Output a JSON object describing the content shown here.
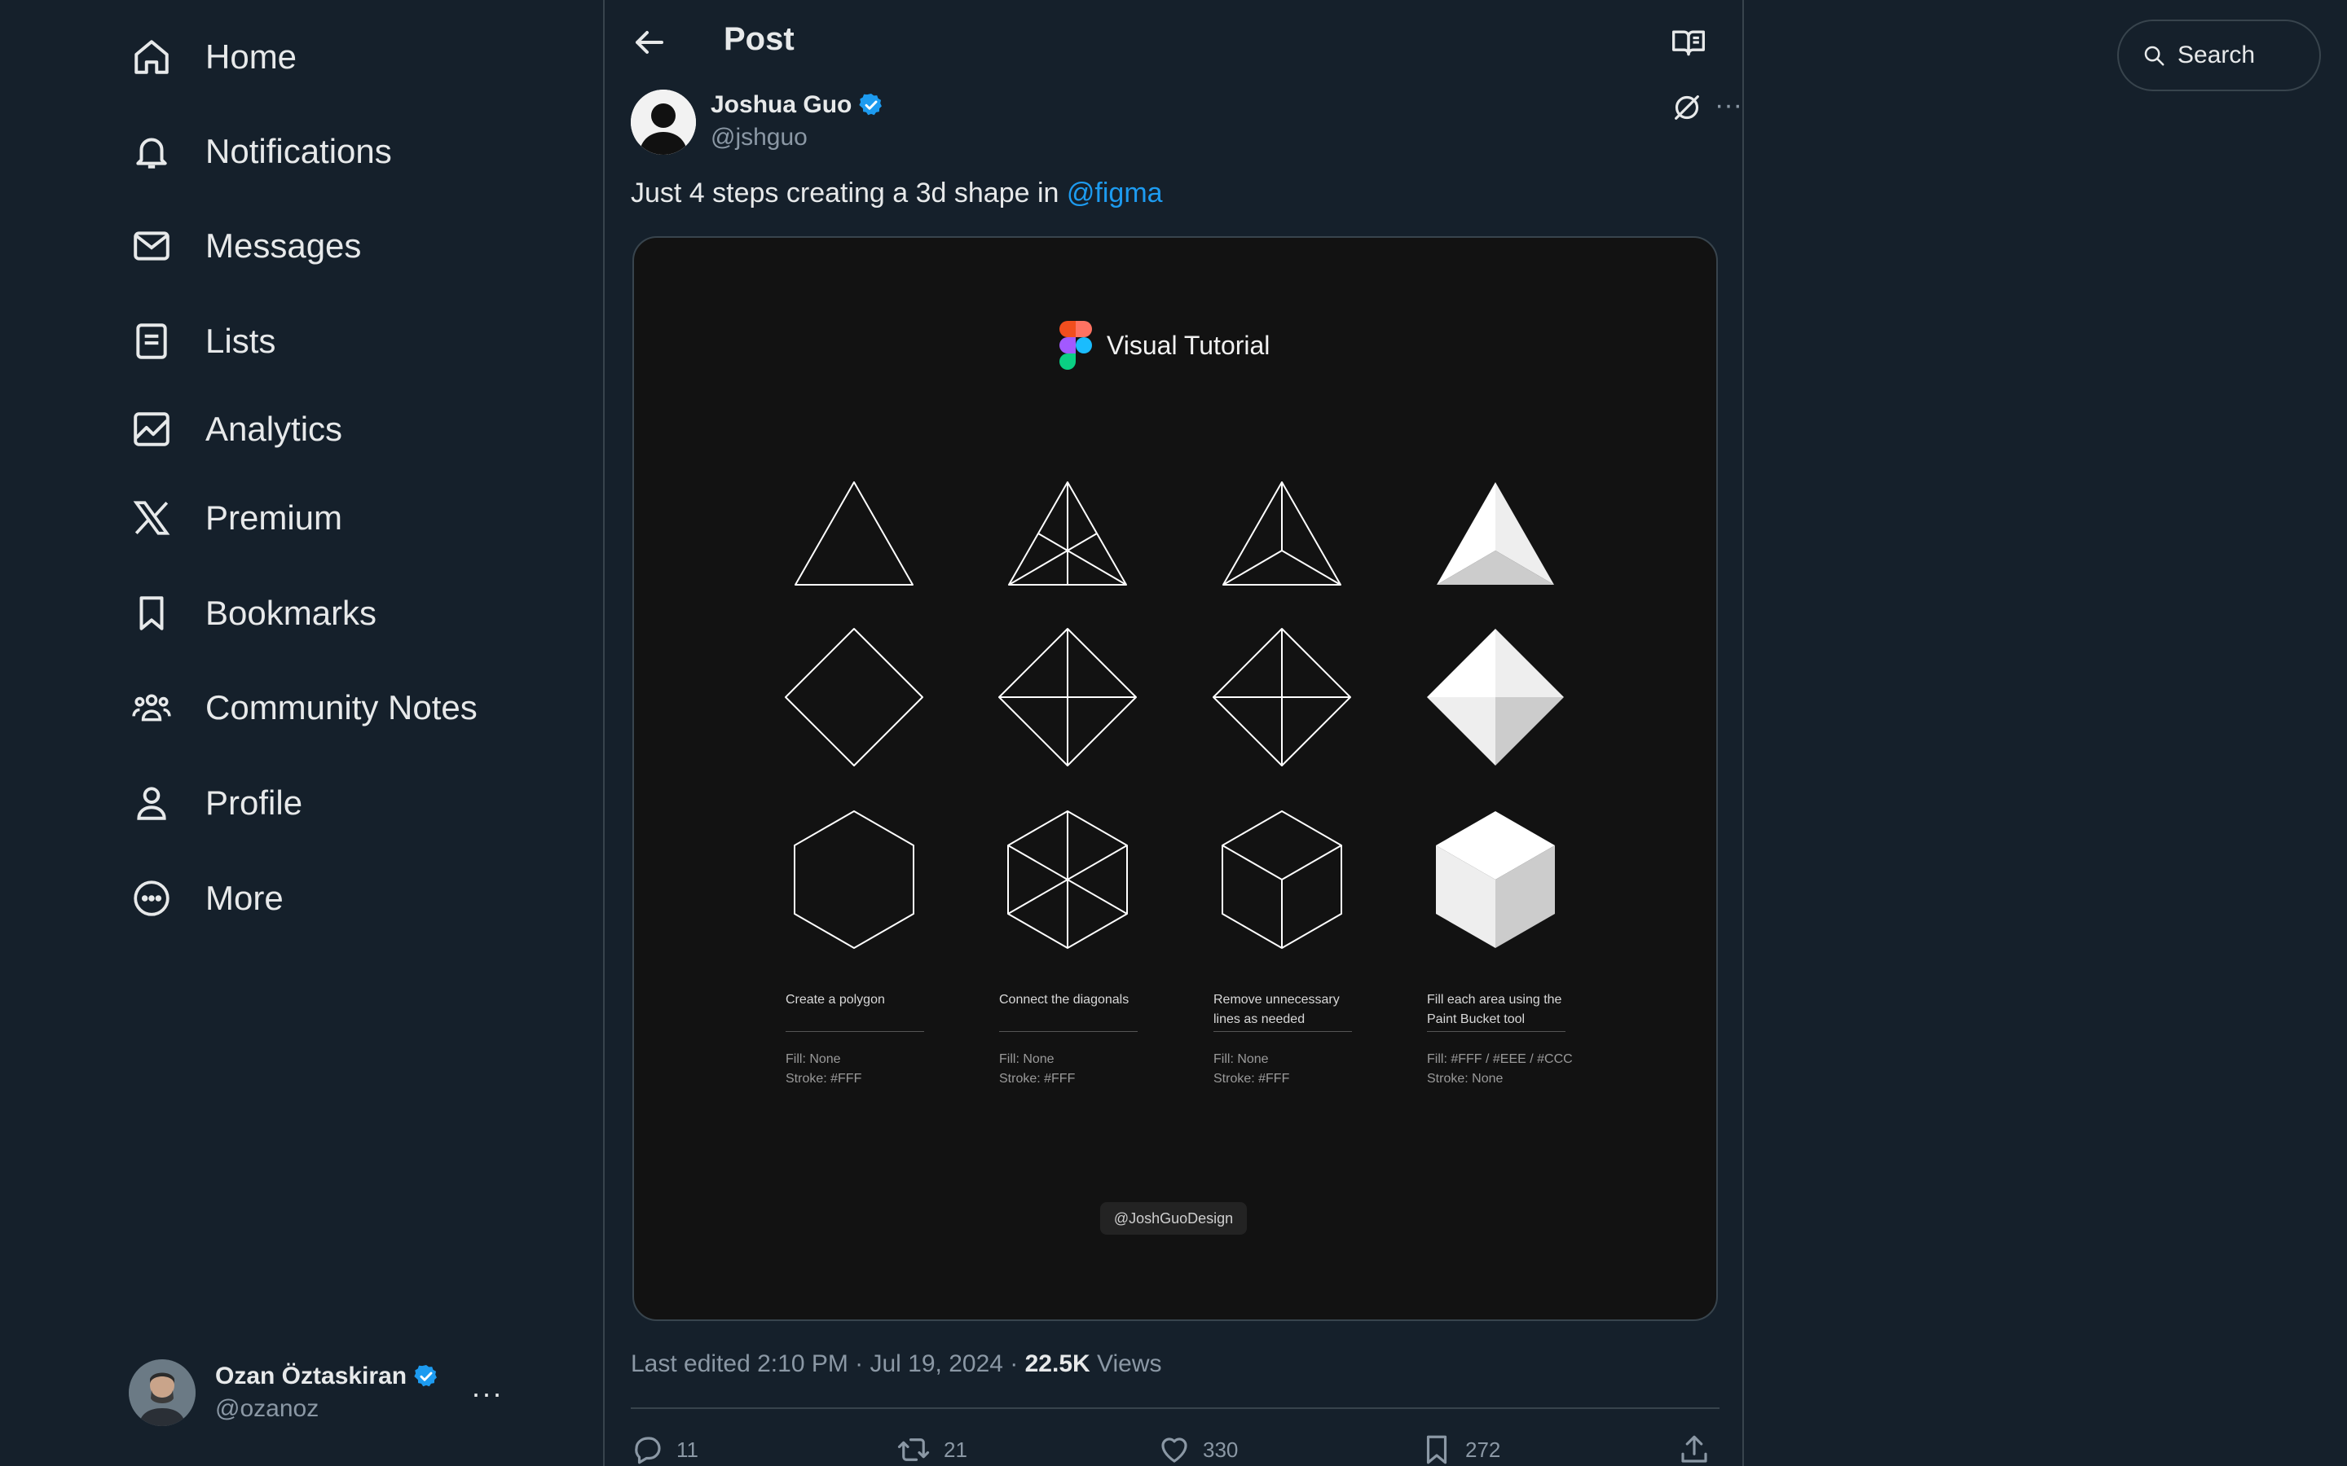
{
  "nav": {
    "items": [
      {
        "label": "Home",
        "icon": "home-icon"
      },
      {
        "label": "Notifications",
        "icon": "bell-icon"
      },
      {
        "label": "Messages",
        "icon": "envelope-icon"
      },
      {
        "label": "Lists",
        "icon": "list-icon"
      },
      {
        "label": "Analytics",
        "icon": "analytics-icon"
      },
      {
        "label": "Premium",
        "icon": "x-logo-icon"
      },
      {
        "label": "Bookmarks",
        "icon": "bookmark-icon"
      },
      {
        "label": "Community Notes",
        "icon": "people-icon"
      },
      {
        "label": "Profile",
        "icon": "person-icon"
      },
      {
        "label": "More",
        "icon": "more-circle-icon"
      }
    ]
  },
  "account": {
    "name": "Ozan Öztaskiran",
    "handle": "@ozanoz",
    "more": "···"
  },
  "header": {
    "title": "Post"
  },
  "post": {
    "author_name": "Joshua Guo",
    "author_handle": "@jshguo",
    "more": "···",
    "text": "Just 4 steps creating a 3d shape in ",
    "mention": "@figma",
    "media": {
      "heading": "Visual Tutorial",
      "steps": [
        {
          "caption": "Create a polygon",
          "fill": "Fill: None",
          "stroke": "Stroke: #FFF"
        },
        {
          "caption": "Connect the diagonals",
          "fill": "Fill: None",
          "stroke": "Stroke: #FFF"
        },
        {
          "caption": "Remove unnecessary lines as needed",
          "fill": "Fill: None",
          "stroke": "Stroke: #FFF"
        },
        {
          "caption": "Fill each area using the Paint Bucket tool",
          "fill": "Fill: #FFF / #EEE / #CCC",
          "stroke": "Stroke: None"
        }
      ],
      "watermark": "@JoshGuoDesign"
    },
    "edited": "Last edited 2:10 PM · Jul 19, 2024 · ",
    "views_count": "22.5K",
    "views_label": " Views",
    "actions": {
      "replies": "11",
      "reposts": "21",
      "likes": "330",
      "bookmarks": "272"
    }
  },
  "search": {
    "placeholder": "Search"
  },
  "colors": {
    "background": "#15202b",
    "accent": "#1d9bf0",
    "border": "#38444d",
    "muted": "#8b98a5"
  }
}
